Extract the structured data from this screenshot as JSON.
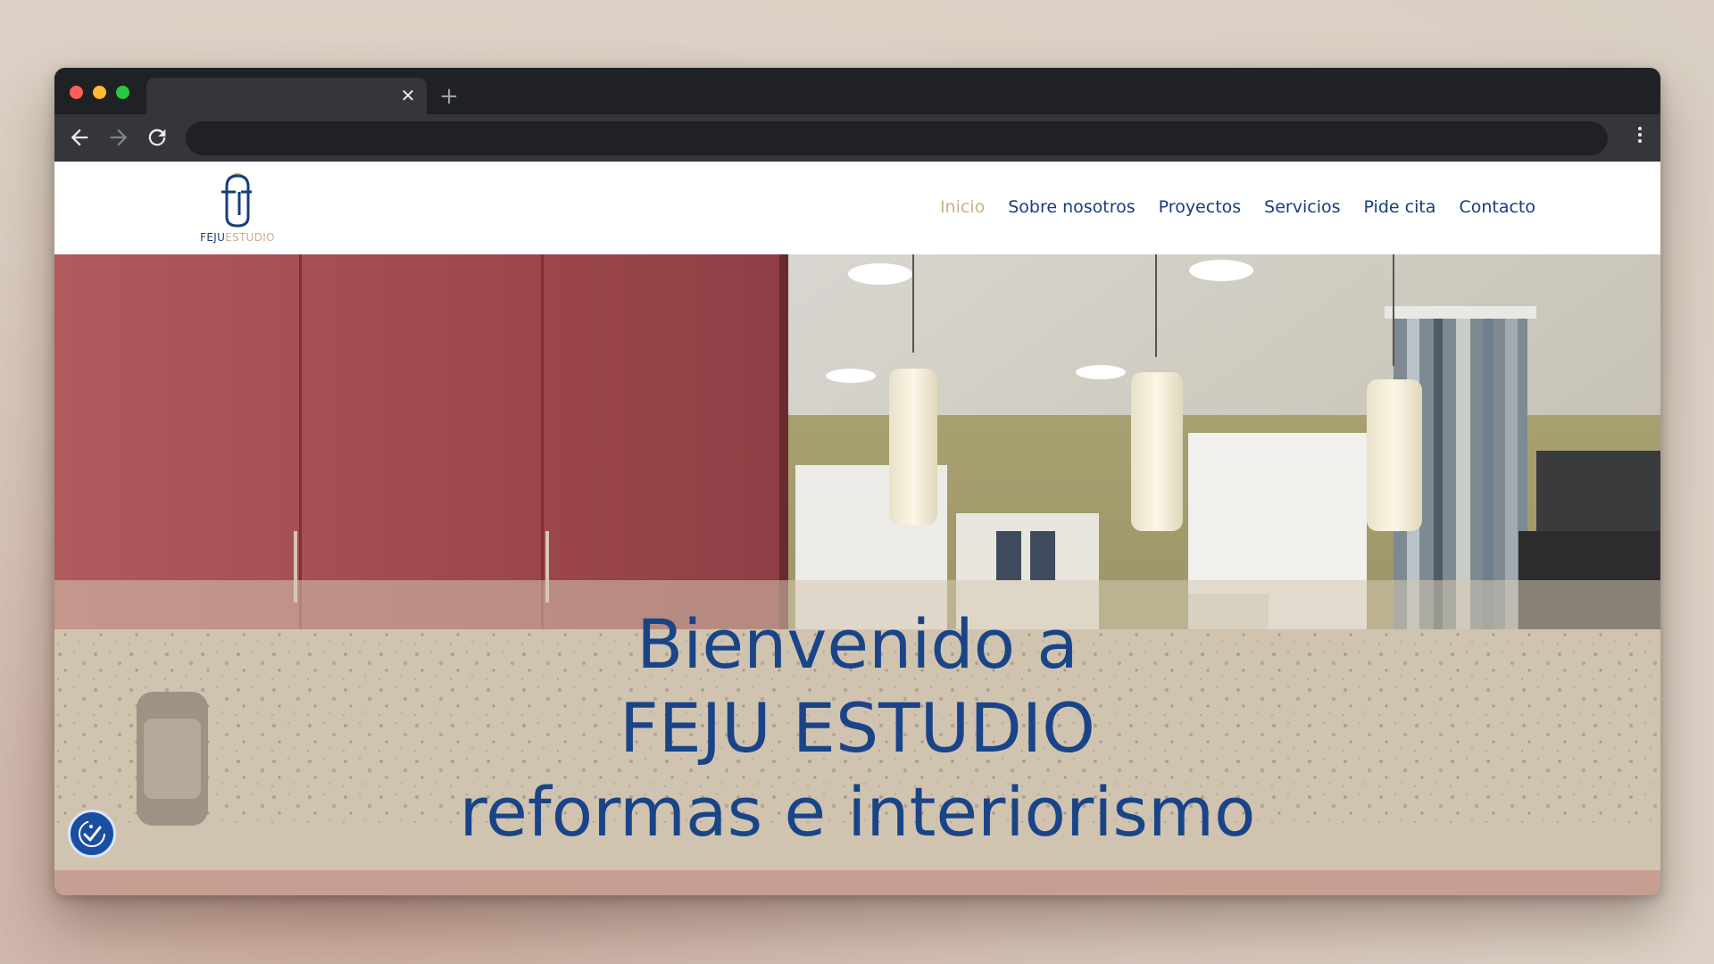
{
  "browser": {
    "tab_title": "",
    "tab_close_icon": "✕",
    "new_tab_icon": "+",
    "address": "",
    "icons": [
      "back-arrow-icon",
      "forward-arrow-icon",
      "reload-icon",
      "kebab-menu-icon"
    ]
  },
  "site": {
    "logo_text_primary": "FEJU",
    "logo_text_secondary": "ESTUDIO",
    "nav": [
      {
        "label": "Inicio",
        "active": true
      },
      {
        "label": "Sobre nosotros",
        "active": false
      },
      {
        "label": "Proyectos",
        "active": false
      },
      {
        "label": "Servicios",
        "active": false
      },
      {
        "label": "Pide cita",
        "active": false
      },
      {
        "label": "Contacto",
        "active": false
      }
    ],
    "hero": {
      "line1": "Bienvenido a",
      "line2": "FEJU ESTUDIO",
      "line3": "reformas e interiorismo"
    },
    "accessibility_icon": "accessibility-check-icon"
  },
  "colors": {
    "brand_blue": "#1a4488",
    "nav_active": "#c7b189",
    "cabinet_red": "#a84c52",
    "browser_dark": "#202124"
  }
}
